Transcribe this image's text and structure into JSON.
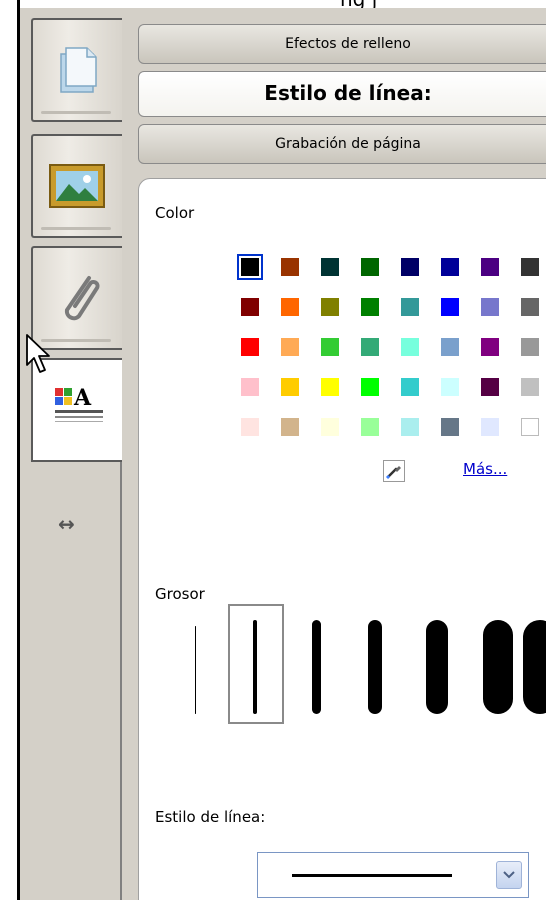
{
  "top": {
    "fragment": "ng   j"
  },
  "side_tabs": [
    {
      "name": "page",
      "icon": "page-icon"
    },
    {
      "name": "image",
      "icon": "picture-icon"
    },
    {
      "name": "attachment",
      "icon": "paperclip-icon"
    },
    {
      "name": "properties",
      "icon": "properties-icon",
      "active": true
    }
  ],
  "collapse_icon": "double-arrow-icon",
  "tabs": {
    "fill_effects": "Efectos de relleno",
    "line_style": "Estilo de línea:",
    "page_recording": "Grabación de página"
  },
  "color": {
    "label": "Color",
    "more_label": "Más...",
    "dropper_icon": "eyedropper-icon",
    "selected": "#000000",
    "rows": [
      [
        "#000000",
        "#993300",
        "#003333",
        "#006600",
        "#000066",
        "#000099",
        "#4b0082",
        "#333333"
      ],
      [
        "#800000",
        "#ff6600",
        "#808000",
        "#008000",
        "#339999",
        "#0000ff",
        "#7777cc",
        "#666666"
      ],
      [
        "#ff0000",
        "#ffaa55",
        "#33cc33",
        "#33aa77",
        "#77ffdd",
        "#7aa0cc",
        "#800080",
        "#999999"
      ],
      [
        "#ffc0cb",
        "#ffcc00",
        "#ffff00",
        "#00ff00",
        "#33cccc",
        "#ccffff",
        "#550044",
        "#c0c0c0"
      ],
      [
        "#ffe4e1",
        "#d2b48c",
        "#ffffdd",
        "#99ff99",
        "#aaeeee",
        "#667788",
        "#e0e8ff",
        "#ffffff"
      ]
    ]
  },
  "thickness": {
    "label": "Grosor",
    "selected_index": 1,
    "widths": [
      1,
      4,
      9,
      14,
      22,
      30,
      34
    ]
  },
  "line_style": {
    "label": "Estilo de línea:",
    "selected": "solid",
    "arrow_icon": "chevron-down-icon"
  }
}
